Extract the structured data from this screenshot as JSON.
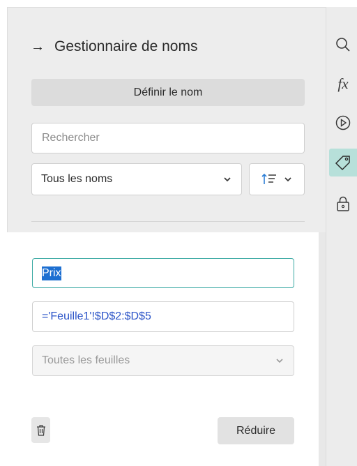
{
  "panel": {
    "title": "Gestionnaire de noms",
    "define_button": "Définir le nom",
    "search": {
      "placeholder": "Rechercher",
      "value": ""
    },
    "filter_select": {
      "selected": "Tous les noms"
    },
    "sort_button": {
      "icon": "sort-icon"
    }
  },
  "editor": {
    "name_value": "Prix",
    "formula_value": "='Feuille1'!$D$2:$D$5",
    "scope_select": {
      "selected": "Toutes les feuilles"
    },
    "reduce_button": "Réduire"
  },
  "rail": {
    "fx_label": "fx",
    "icons": [
      "search-icon",
      "formula-icon",
      "play-icon",
      "tag-icon",
      "lock-icon"
    ],
    "active_icon": "tag-icon"
  },
  "colors": {
    "panel_bg": "#ededed",
    "accent_border": "#3aa9a3",
    "active_rail_bg": "#b7e0da",
    "selection_bg": "#1d6fd1",
    "formula_text": "#2b54c8"
  }
}
